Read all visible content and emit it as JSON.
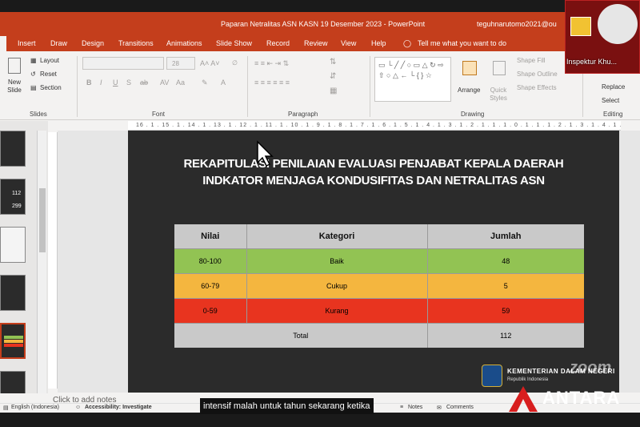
{
  "window": {
    "title": "Paparan Netralitas ASN KASN 19 Desember 2023  -  PowerPoint",
    "user": "teguhnarutomo2021@ou"
  },
  "tabs": [
    {
      "label": "Insert"
    },
    {
      "label": "Draw"
    },
    {
      "label": "Design"
    },
    {
      "label": "Transitions"
    },
    {
      "label": "Animations"
    },
    {
      "label": "Slide Show"
    },
    {
      "label": "Record"
    },
    {
      "label": "Review"
    },
    {
      "label": "View"
    },
    {
      "label": "Help"
    }
  ],
  "tell_me": "Tell me what you want to do",
  "ribbon": {
    "new_slide": "New Slide",
    "layout": "Layout",
    "reset": "Reset",
    "section": "Section",
    "slides_group": "Slides",
    "font_size": "28",
    "font_group": "Font",
    "paragraph_group": "Paragraph",
    "arrange": "Arrange",
    "quick_styles": "Quick Styles",
    "shape_fill": "Shape Fill",
    "shape_outline": "Shape Outline",
    "shape_effects": "Shape Effects",
    "drawing_group": "Drawing",
    "replace": "Replace",
    "select": "Select",
    "editing_group": "Editing"
  },
  "ruler_text": "16 . 1 . 15 . 1 . 14 . 1 . 13 . 1 . 12 . 1 . 11 . 1 . 10 . 1 . 9 . 1 . 8 . 1 . 7 . 1 . 6 . 1 . 5 . 1 . 4 . 1 . 3 . 1 . 2 . 1 . 1 . 1 . 0 . 1 . 1 . 1 . 2 . 1 . 3 . 1 . 4 . 1 . 5 . 1 . 6 . 1 . 7 . 1 . 8 . 1 . 9 . 1 . 10 . 1 . 11 . 1 . 12 . 1 . 13 . 1 . 14 . 1 . 15 . 1 . 16",
  "slide": {
    "title_line1": "REKAPITULASI PENILAIAN EVALUASI PENJABAT KEPALA DAERAH",
    "title_line2": "INDKATOR MENJAGA KONDUSIFITAS DAN NETRALITAS ASN",
    "table": {
      "headers": [
        "Nilai",
        "Kategori",
        "Jumlah"
      ],
      "rows": [
        {
          "nilai": "80-100",
          "kategori": "Baik",
          "jumlah": "48",
          "color": "#92c353"
        },
        {
          "nilai": "60-79",
          "kategori": "Cukup",
          "jumlah": "5",
          "color": "#f4b63f"
        },
        {
          "nilai": "0-59",
          "kategori": "Kurang",
          "jumlah": "59",
          "color": "#e8341f"
        }
      ],
      "total_label": "Total",
      "total_value": "112"
    },
    "org_name": "KEMENTERIAN DALAM NEGERI",
    "org_sub": "Republik Indonesia"
  },
  "notes_hint": "Click to add notes",
  "status": {
    "language": "English (Indonesia)",
    "accessibility": "Accessibility: Investigate",
    "notes": "Notes",
    "comments": "Comments"
  },
  "caption": "intensif malah untuk tahun sekarang ketika",
  "webcam_name": "Inspektur Khu...",
  "watermark_zoom": "zoom",
  "watermark_antara": "ANTARA",
  "colors": {
    "accent": "#c43e1c",
    "header_gray": "#c9c9c9",
    "total_gray": "#c9c9c9"
  }
}
